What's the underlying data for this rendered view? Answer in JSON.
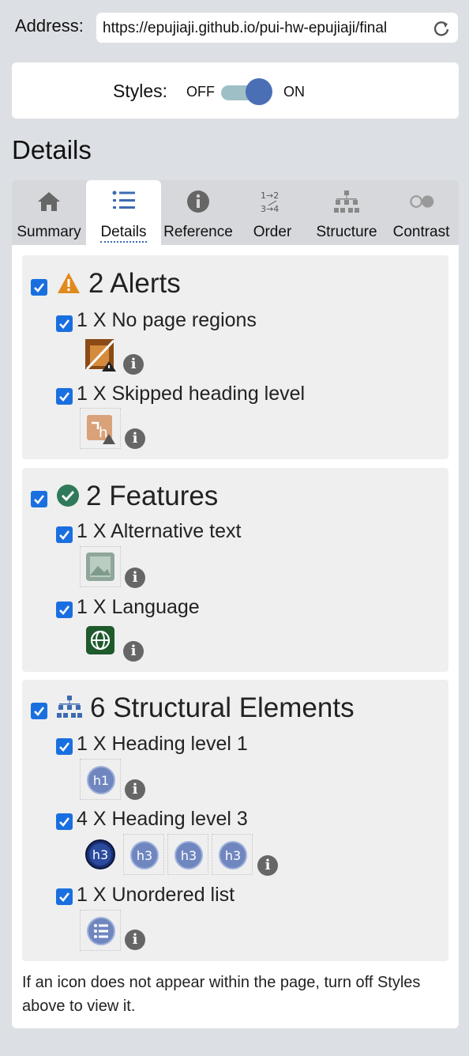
{
  "address": {
    "label": "Address:",
    "url": "https://epujiaji.github.io/pui-hw-epujiaji/final"
  },
  "styles": {
    "label": "Styles:",
    "off": "OFF",
    "on": "ON"
  },
  "details_title": "Details",
  "tabs": [
    {
      "label": "Summary",
      "icon": "home-icon"
    },
    {
      "label": "Details",
      "icon": "list-icon"
    },
    {
      "label": "Reference",
      "icon": "info-icon"
    },
    {
      "label": "Order",
      "icon": "order-icon"
    },
    {
      "label": "Structure",
      "icon": "structure-icon"
    },
    {
      "label": "Contrast",
      "icon": "contrast-icon"
    }
  ],
  "active_tab": "Details",
  "sections": [
    {
      "title": "2 Alerts",
      "icon": "warning-icon",
      "items": [
        {
          "label": "1 X No page regions",
          "icon": "no-regions-icon"
        },
        {
          "label": "1 X Skipped heading level",
          "icon": "skipped-heading-icon"
        }
      ]
    },
    {
      "title": "2 Features",
      "icon": "check-circle-icon",
      "items": [
        {
          "label": "1 X Alternative text",
          "icon": "image-icon"
        },
        {
          "label": "1 X Language",
          "icon": "globe-icon"
        }
      ]
    },
    {
      "title": "6 Structural Elements",
      "icon": "hierarchy-icon",
      "items": [
        {
          "label": "1 X Heading level 1",
          "badges": [
            "h1"
          ]
        },
        {
          "label": "4 X Heading level 3",
          "badges": [
            "h3",
            "h3",
            "h3",
            "h3"
          ]
        },
        {
          "label": "1 X Unordered list",
          "icon": "list-icon"
        }
      ]
    }
  ],
  "footnote": "If an icon does not appear within the page, turn off Styles above to view it.",
  "colors": {
    "accent": "#1a6fe0",
    "toggle_knob": "#4a6fb5",
    "toggle_track": "#9fbfc7",
    "warning": "#e08a1e",
    "success": "#2f7a5a",
    "structure": "#3d6bb3"
  }
}
